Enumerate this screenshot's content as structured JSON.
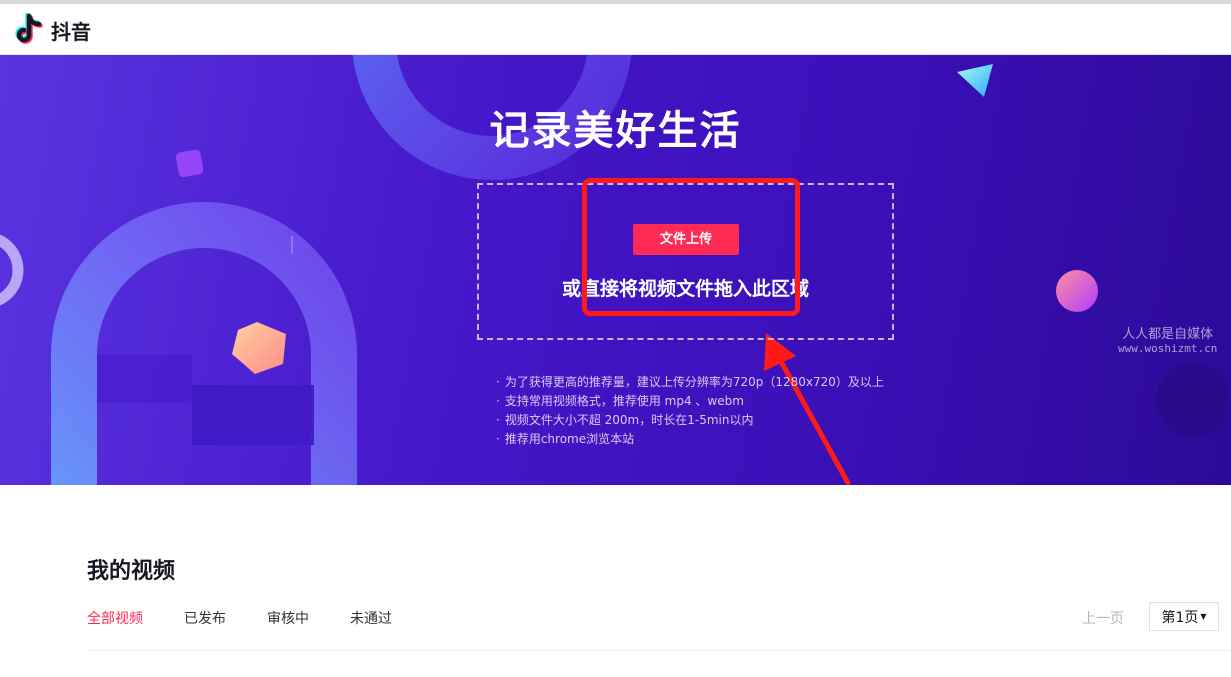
{
  "header": {
    "app_name": "抖音"
  },
  "hero": {
    "title": "记录美好生活",
    "upload_button_label": "文件上传",
    "drop_text": "或直接将视频文件拖入此区域",
    "tips": [
      "为了获得更高的推荐量，建议上传分辨率为720p（1280x720）及以上",
      "支持常用视频格式，推荐使用 mp4 、webm",
      "视频文件大小不超 200m，时长在1-5min以内",
      "推荐用chrome浏览本站"
    ],
    "watermark": {
      "line1": "人人都是自媒体",
      "line2": "www.woshizmt.cn"
    }
  },
  "videos": {
    "title": "我的视频",
    "tabs": [
      {
        "label": "全部视频",
        "active": true
      },
      {
        "label": "已发布",
        "active": false
      },
      {
        "label": "审核中",
        "active": false
      },
      {
        "label": "未通过",
        "active": false
      }
    ],
    "pagination": {
      "prev_label": "上一页",
      "current_page_label": "第1页"
    }
  },
  "colors": {
    "brand_red": "#fe2c55",
    "hero_bg": "#4416c8",
    "annotation_red": "#ff1a1a"
  },
  "icons": {
    "logo": "tiktok-note-icon",
    "dropdown": "caret-down-icon"
  }
}
